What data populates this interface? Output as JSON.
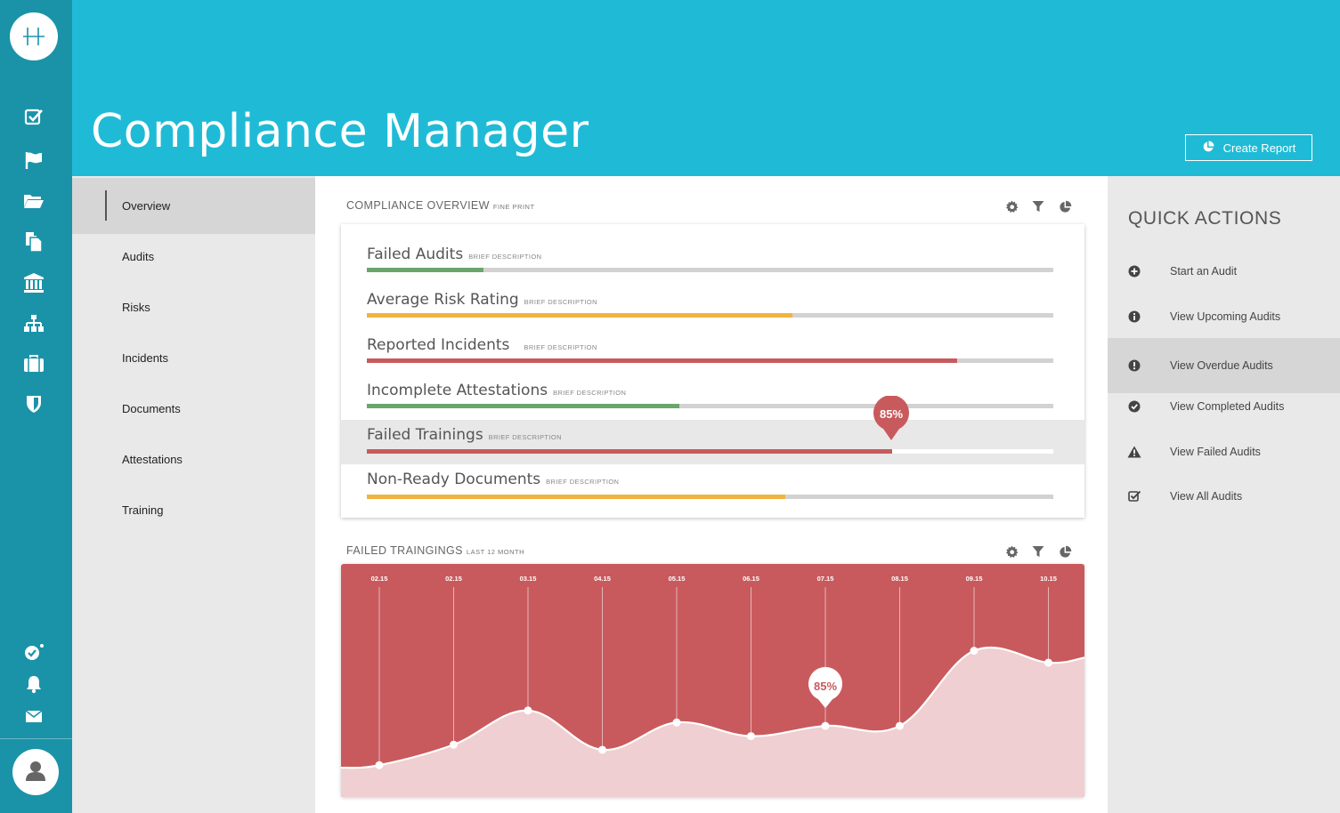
{
  "app": {
    "title": "Compliance Manager",
    "logo_icon": "h-logo-icon"
  },
  "rail": {
    "icons": [
      "checkbox-icon",
      "flag-icon",
      "folder-icon",
      "documents-icon",
      "bank-icon",
      "org-chart-icon",
      "briefcase-icon",
      "shield-icon"
    ],
    "bottom_icons": [
      "check-badge-icon",
      "bell-icon",
      "mail-icon"
    ],
    "avatar_icon": "user-icon"
  },
  "header": {
    "create_report_label": "Create Report",
    "create_report_icon": "pie-chart-icon"
  },
  "subnav": {
    "items": [
      {
        "label": "Overview",
        "active": true
      },
      {
        "label": "Audits",
        "active": false
      },
      {
        "label": "Risks",
        "active": false
      },
      {
        "label": "Incidents",
        "active": false
      },
      {
        "label": "Documents",
        "active": false
      },
      {
        "label": "Attestations",
        "active": false
      },
      {
        "label": "Training",
        "active": false
      }
    ]
  },
  "overview": {
    "title": "COMPLIANCE OVERVIEW",
    "fine_print": "FINE PRINT",
    "tool_icons": [
      "gear-icon",
      "filter-icon",
      "pie-chart-icon"
    ],
    "metrics": [
      {
        "name": "Failed Audits",
        "desc": "BRIEF DESCRIPTION",
        "value": 0.17,
        "color": "#6aa66c"
      },
      {
        "name": "Average Risk Rating",
        "desc": "BRIEF DESCRIPTION",
        "value": 0.62,
        "color": "#f2b440"
      },
      {
        "name": "Reported Incidents",
        "desc": "BRIEF DESCRIPTION",
        "value": 0.86,
        "color": "#c85a5d"
      },
      {
        "name": "Incomplete Attestations",
        "desc": "BRIEF DESCRIPTION",
        "value": 0.455,
        "color": "#6aa66c"
      },
      {
        "name": "Failed Trainings",
        "desc": "BRIEF DESCRIPTION",
        "value": 0.765,
        "color": "#c85a5d",
        "highlight": true,
        "badge": "85%"
      },
      {
        "name": "Non-Ready Documents",
        "desc": "BRIEF DESCRIPTION",
        "value": 0.61,
        "color": "#f2b440"
      }
    ]
  },
  "failed_trainings": {
    "title": "FAILED TRAINGINGS",
    "fine_print": "LAST 12 MONTH",
    "tool_icons": [
      "gear-icon",
      "filter-icon",
      "pie-chart-icon"
    ],
    "badge": "85%"
  },
  "chart_data": {
    "type": "area",
    "title": "FAILED TRAINGINGS",
    "subtitle": "LAST 12 MONTH",
    "categories": [
      "02.15",
      "02.15",
      "03.15",
      "04.15",
      "05.15",
      "06.15",
      "07.15",
      "08.15",
      "09.15",
      "10.15"
    ],
    "values": [
      3,
      15,
      35,
      12,
      28,
      20,
      26,
      26,
      70,
      63
    ],
    "ylim": [
      0,
      100
    ],
    "highlight_index": 6,
    "highlight_label": "85%",
    "colors": {
      "background": "#c85a5d",
      "area": "#efcfd1",
      "line": "#ffffff"
    }
  },
  "quick_actions": {
    "title": "QUICK ACTIONS",
    "items": [
      {
        "label": "Start an Audit",
        "icon": "plus-circle-icon",
        "active": false
      },
      {
        "label": "View Upcoming Audits",
        "icon": "info-circle-icon",
        "active": false
      },
      {
        "label": "View Overdue Audits",
        "icon": "exclamation-circle-icon",
        "active": true
      },
      {
        "label": "View Completed Audits",
        "icon": "check-circle-icon",
        "active": false
      },
      {
        "label": "View Failed Audits",
        "icon": "warning-triangle-icon",
        "active": false
      },
      {
        "label": "View All Audits",
        "icon": "checkbox-icon",
        "active": false
      }
    ]
  },
  "colors": {
    "rail": "#1a93a8",
    "header": "#1fbbd6",
    "panel": "#e9e9e9",
    "red": "#c85a5d",
    "green": "#6aa66c",
    "orange": "#f2b440"
  }
}
